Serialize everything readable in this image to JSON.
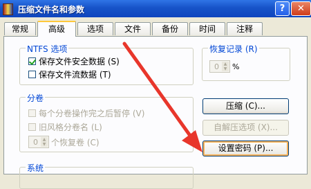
{
  "window": {
    "title": "压缩文件名和参数",
    "help_icon": "?",
    "close_icon": "✕"
  },
  "tabs": [
    "常规",
    "高级",
    "选项",
    "文件",
    "备份",
    "时间",
    "注释"
  ],
  "active_tab": "高级",
  "ntfs": {
    "title": "NTFS 选项",
    "options": [
      {
        "label": "保存文件安全数据 (S)",
        "checked": true
      },
      {
        "label": "保存文件流数据 (T)",
        "checked": false
      }
    ]
  },
  "recovery_record": {
    "title": "恢复记录 (R)",
    "value": "0",
    "unit": "%"
  },
  "split": {
    "title": "分卷",
    "options": [
      {
        "label": "每个分卷操作完之后暂停 (V)",
        "checked": false,
        "enabled": false
      },
      {
        "label": "旧风格分卷名 (L)",
        "checked": false,
        "enabled": false
      }
    ],
    "recovery_volumes": {
      "value": "0",
      "label": "个恢复卷 (C)"
    }
  },
  "buttons": {
    "compress": "压缩 (C)...",
    "sfx_options": "自解压选项 (X)...",
    "set_password": "设置密码 (P)..."
  },
  "system_group_title": "系统",
  "colors": {
    "titlebar": "#1753C8",
    "accent_arrow": "#E8362B",
    "group_title": "#0046D5"
  }
}
